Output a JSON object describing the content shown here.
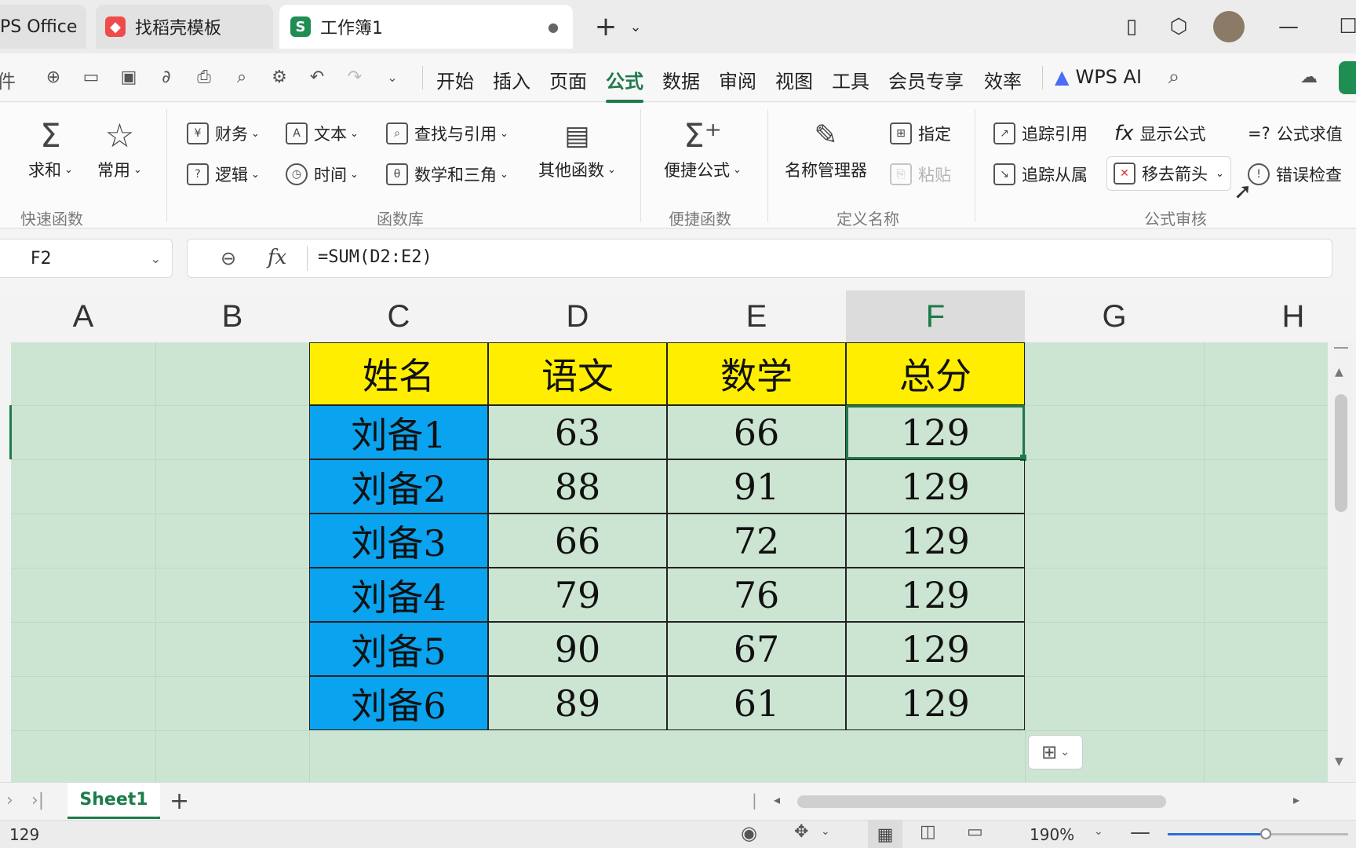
{
  "titlebar": {
    "tabs": [
      {
        "label": "PS Office",
        "icon": "wps-icon"
      },
      {
        "label": "找稻壳模板",
        "icon": "docer-icon"
      },
      {
        "label": "工作簿1",
        "icon": "spreadsheet-icon",
        "badge": "S",
        "modified": "●"
      }
    ],
    "new_tab": "+",
    "new_tab_menu": "⌄"
  },
  "menu": {
    "partial_left": "件",
    "items": [
      "开始",
      "插入",
      "页面",
      "公式",
      "数据",
      "审阅",
      "视图",
      "工具",
      "会员专享",
      "效率"
    ],
    "active": "公式",
    "wps_ai": "WPS AI"
  },
  "ribbon": {
    "quick_functions": {
      "sum": "求和",
      "common": "常用",
      "group": "快速函数"
    },
    "function_library": {
      "finance": "财务",
      "text": "文本",
      "lookup": "查找与引用",
      "logic": "逻辑",
      "time": "时间",
      "math": "数学和三角",
      "other": "其他函数",
      "group": "函数库"
    },
    "convenient": {
      "formula": "便捷公式",
      "group": "便捷函数"
    },
    "defined_names": {
      "manager": "名称管理器",
      "assign": "指定",
      "paste": "粘贴",
      "group": "定义名称"
    },
    "audit": {
      "trace_precedents": "追踪引用",
      "show_formulas": "显示公式",
      "evaluate": "公式求值",
      "trace_dependents": "追踪从属",
      "remove_arrows": "移去箭头",
      "error_check": "错误检查",
      "group": "公式审核"
    }
  },
  "formula_bar": {
    "name_box": "F2",
    "fx": "fx",
    "formula": "=SUM(D2:E2)"
  },
  "grid": {
    "columns": [
      "A",
      "B",
      "C",
      "D",
      "E",
      "F",
      "G",
      "H"
    ],
    "selected_column": "F",
    "headers": [
      "姓名",
      "语文",
      "数学",
      "总分"
    ],
    "rows": [
      {
        "name": "刘备1",
        "chinese": "63",
        "math": "66",
        "total": "129"
      },
      {
        "name": "刘备2",
        "chinese": "88",
        "math": "91",
        "total": "129"
      },
      {
        "name": "刘备3",
        "chinese": "66",
        "math": "72",
        "total": "129"
      },
      {
        "name": "刘备4",
        "chinese": "79",
        "math": "76",
        "total": "129"
      },
      {
        "name": "刘备5",
        "chinese": "90",
        "math": "67",
        "total": "129"
      },
      {
        "name": "刘备6",
        "chinese": "89",
        "math": "61",
        "total": "129"
      }
    ],
    "colors": {
      "header_bg": "#ffee00",
      "name_bg": "#0aa3ef",
      "sheet_bg": "#cce5d3",
      "selection": "#1e7b4a"
    }
  },
  "sheets": {
    "tabs": [
      "Sheet1"
    ],
    "add": "+"
  },
  "status": {
    "value": "129",
    "zoom": "190%"
  }
}
